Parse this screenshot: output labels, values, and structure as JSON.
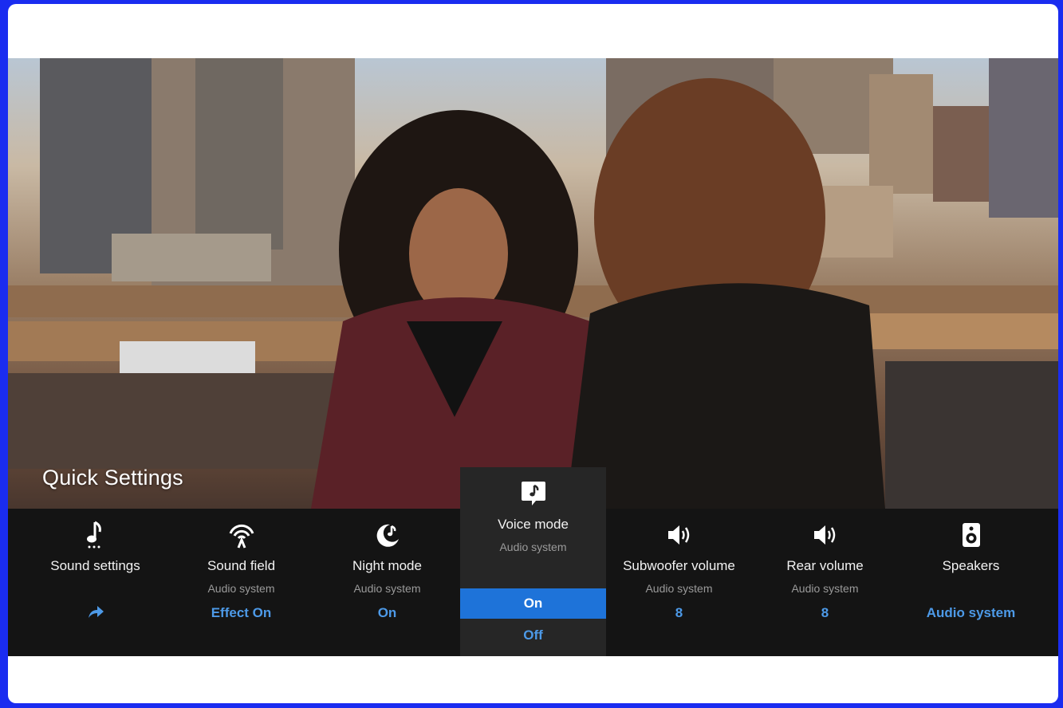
{
  "quick_settings": {
    "title": "Quick Settings"
  },
  "tiles": [
    {
      "name": "Sound settings",
      "subtitle": "",
      "value": "",
      "icon": "music-note-icon",
      "value_icon": "share-arrow-icon"
    },
    {
      "name": "Sound field",
      "subtitle": "Audio system",
      "value": "Effect On",
      "icon": "sound-field-icon"
    },
    {
      "name": "Night mode",
      "subtitle": "Audio system",
      "value": "On",
      "icon": "night-mode-icon"
    },
    {
      "name": "Subwoofer volume",
      "subtitle": "Audio system",
      "value": "8",
      "icon": "speaker-volume-icon"
    },
    {
      "name": "Rear volume",
      "subtitle": "Audio system",
      "value": "8",
      "icon": "speaker-volume-icon"
    },
    {
      "name": "Speakers",
      "subtitle": "",
      "value": "Audio system",
      "icon": "speaker-box-icon"
    }
  ],
  "voice_mode": {
    "name": "Voice mode",
    "subtitle": "Audio system",
    "icon": "voice-bubble-icon",
    "options": [
      "On",
      "Off"
    ],
    "selected": "On"
  },
  "colors": {
    "accent": "#4d9ae8",
    "selected_bg": "#1e73d9",
    "panel_bg": "#141414",
    "frame_border": "#1a2cf0"
  }
}
